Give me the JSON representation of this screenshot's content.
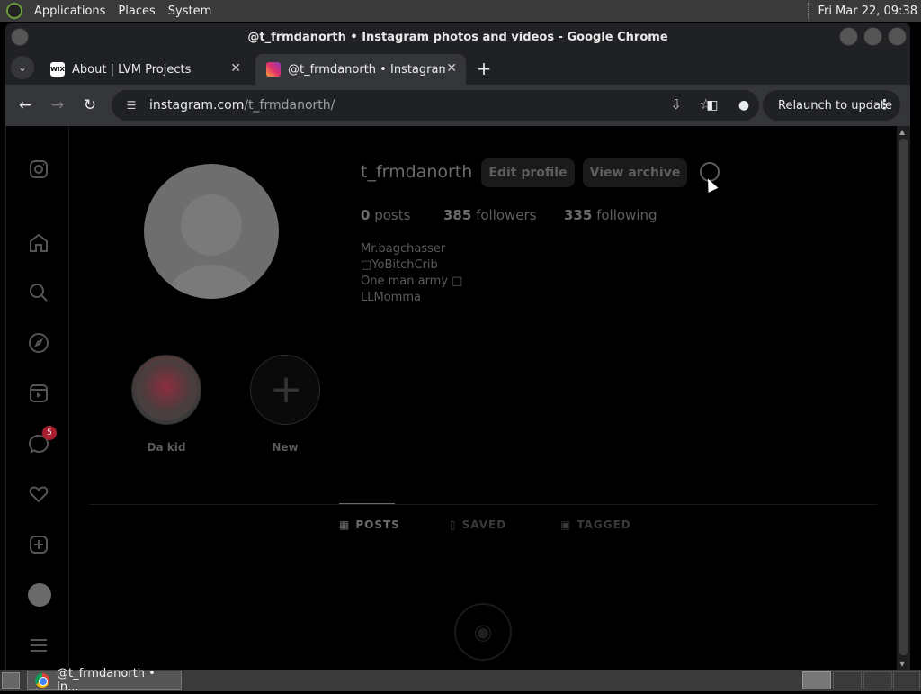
{
  "top_panel": {
    "menus": [
      "Applications",
      "Places",
      "System"
    ],
    "clock": "Fri Mar 22, 09:38"
  },
  "window": {
    "title": "@t_frmdanorth • Instagram photos and videos - Google Chrome"
  },
  "tabs": [
    {
      "title": "About | LVM Projects",
      "favicon_text": "WIX"
    },
    {
      "title": "@t_frmdanorth • Instagram photos and videos"
    }
  ],
  "toolbar": {
    "url_host": "instagram.com",
    "url_path": "/t_frmdanorth/",
    "relaunch_label": "Relaunch to update"
  },
  "profile": {
    "username": "t_frmdanorth",
    "edit_label": "Edit profile",
    "archive_label": "View archive",
    "posts_count": "0",
    "posts_label": " posts",
    "followers_count": "385",
    "followers_label": " followers",
    "following_count": "335",
    "following_label": " following",
    "bio": [
      "Mr.bagchasser",
      "□YoBitchCrib",
      "One man army □",
      "LLMomma"
    ]
  },
  "nav": {
    "messages_badge": "5"
  },
  "highlights": [
    {
      "label": "Da kid"
    },
    {
      "label": "New"
    }
  ],
  "profile_tabs": {
    "posts": "POSTS",
    "saved": "SAVED",
    "tagged": "TAGGED"
  },
  "taskbar": {
    "item_label": "@t_frmdanorth • In..."
  }
}
